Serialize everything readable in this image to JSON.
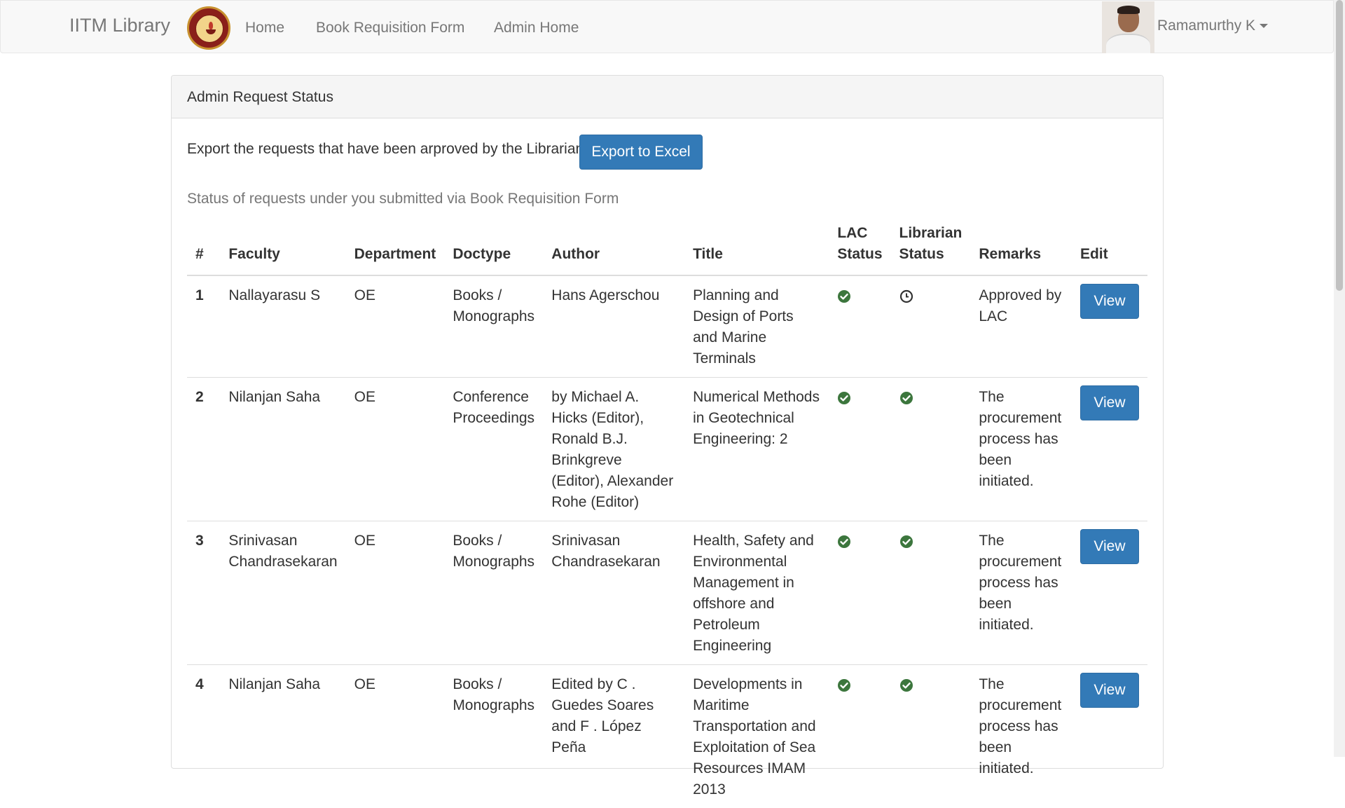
{
  "navbar": {
    "brand": "IITM Library",
    "links": [
      "Home",
      "Book Requisition Form",
      "Admin Home"
    ],
    "user": "Ramamurthy K"
  },
  "panel": {
    "heading": "Admin Request Status",
    "export_text": "Export the requests that have been arproved by the Librarian",
    "export_button": "Export to Excel",
    "status_text": "Status of requests under you submitted via Book Requisition Form"
  },
  "table": {
    "headers": [
      "#",
      "Faculty",
      "Department",
      "Doctype",
      "Author",
      "Title",
      "LAC Status",
      "Librarian Status",
      "Remarks",
      "Edit"
    ],
    "rows": [
      {
        "num": "1",
        "faculty": "Nallayarasu S",
        "department": "OE",
        "doctype": "Books / Monographs",
        "author": "Hans Agerschou",
        "title": "Planning and Design of Ports and Marine Terminals",
        "lac_status": "check-circle-icon",
        "librarian_status": "clock-icon",
        "remarks": "Approved by LAC",
        "edit": "View"
      },
      {
        "num": "2",
        "faculty": "Nilanjan Saha",
        "department": "OE",
        "doctype": "Conference Proceedings",
        "author": "by Michael A. Hicks (Editor), Ronald B.J. Brinkgreve (Editor), Alexander Rohe (Editor)",
        "title": "Numerical Methods in Geotechnical Engineering: 2",
        "lac_status": "check-circle-icon",
        "librarian_status": "check-circle-icon",
        "remarks": "The procurement process has been initiated.",
        "edit": "View"
      },
      {
        "num": "3",
        "faculty": "Srinivasan Chandrasekaran",
        "department": "OE",
        "doctype": "Books / Monographs",
        "author": "Srinivasan Chandrasekaran",
        "title": "Health, Safety and Environmental Management in offshore and Petroleum Engineering",
        "lac_status": "check-circle-icon",
        "librarian_status": "check-circle-icon",
        "remarks": "The procurement process has been initiated.",
        "edit": "View"
      },
      {
        "num": "4",
        "faculty": "Nilanjan Saha",
        "department": "OE",
        "doctype": "Books / Monographs",
        "author": "Edited by C . Guedes Soares and F . López Peña",
        "title": "Developments in Maritime Transportation and Exploitation of Sea Resources IMAM 2013",
        "lac_status": "check-circle-icon",
        "librarian_status": "check-circle-icon",
        "remarks": "The procurement process has been initiated.",
        "edit": "View"
      }
    ]
  },
  "colors": {
    "primary_button": "#337ab7",
    "success_icon": "#3c763d",
    "navbar_bg": "#f8f8f8"
  }
}
